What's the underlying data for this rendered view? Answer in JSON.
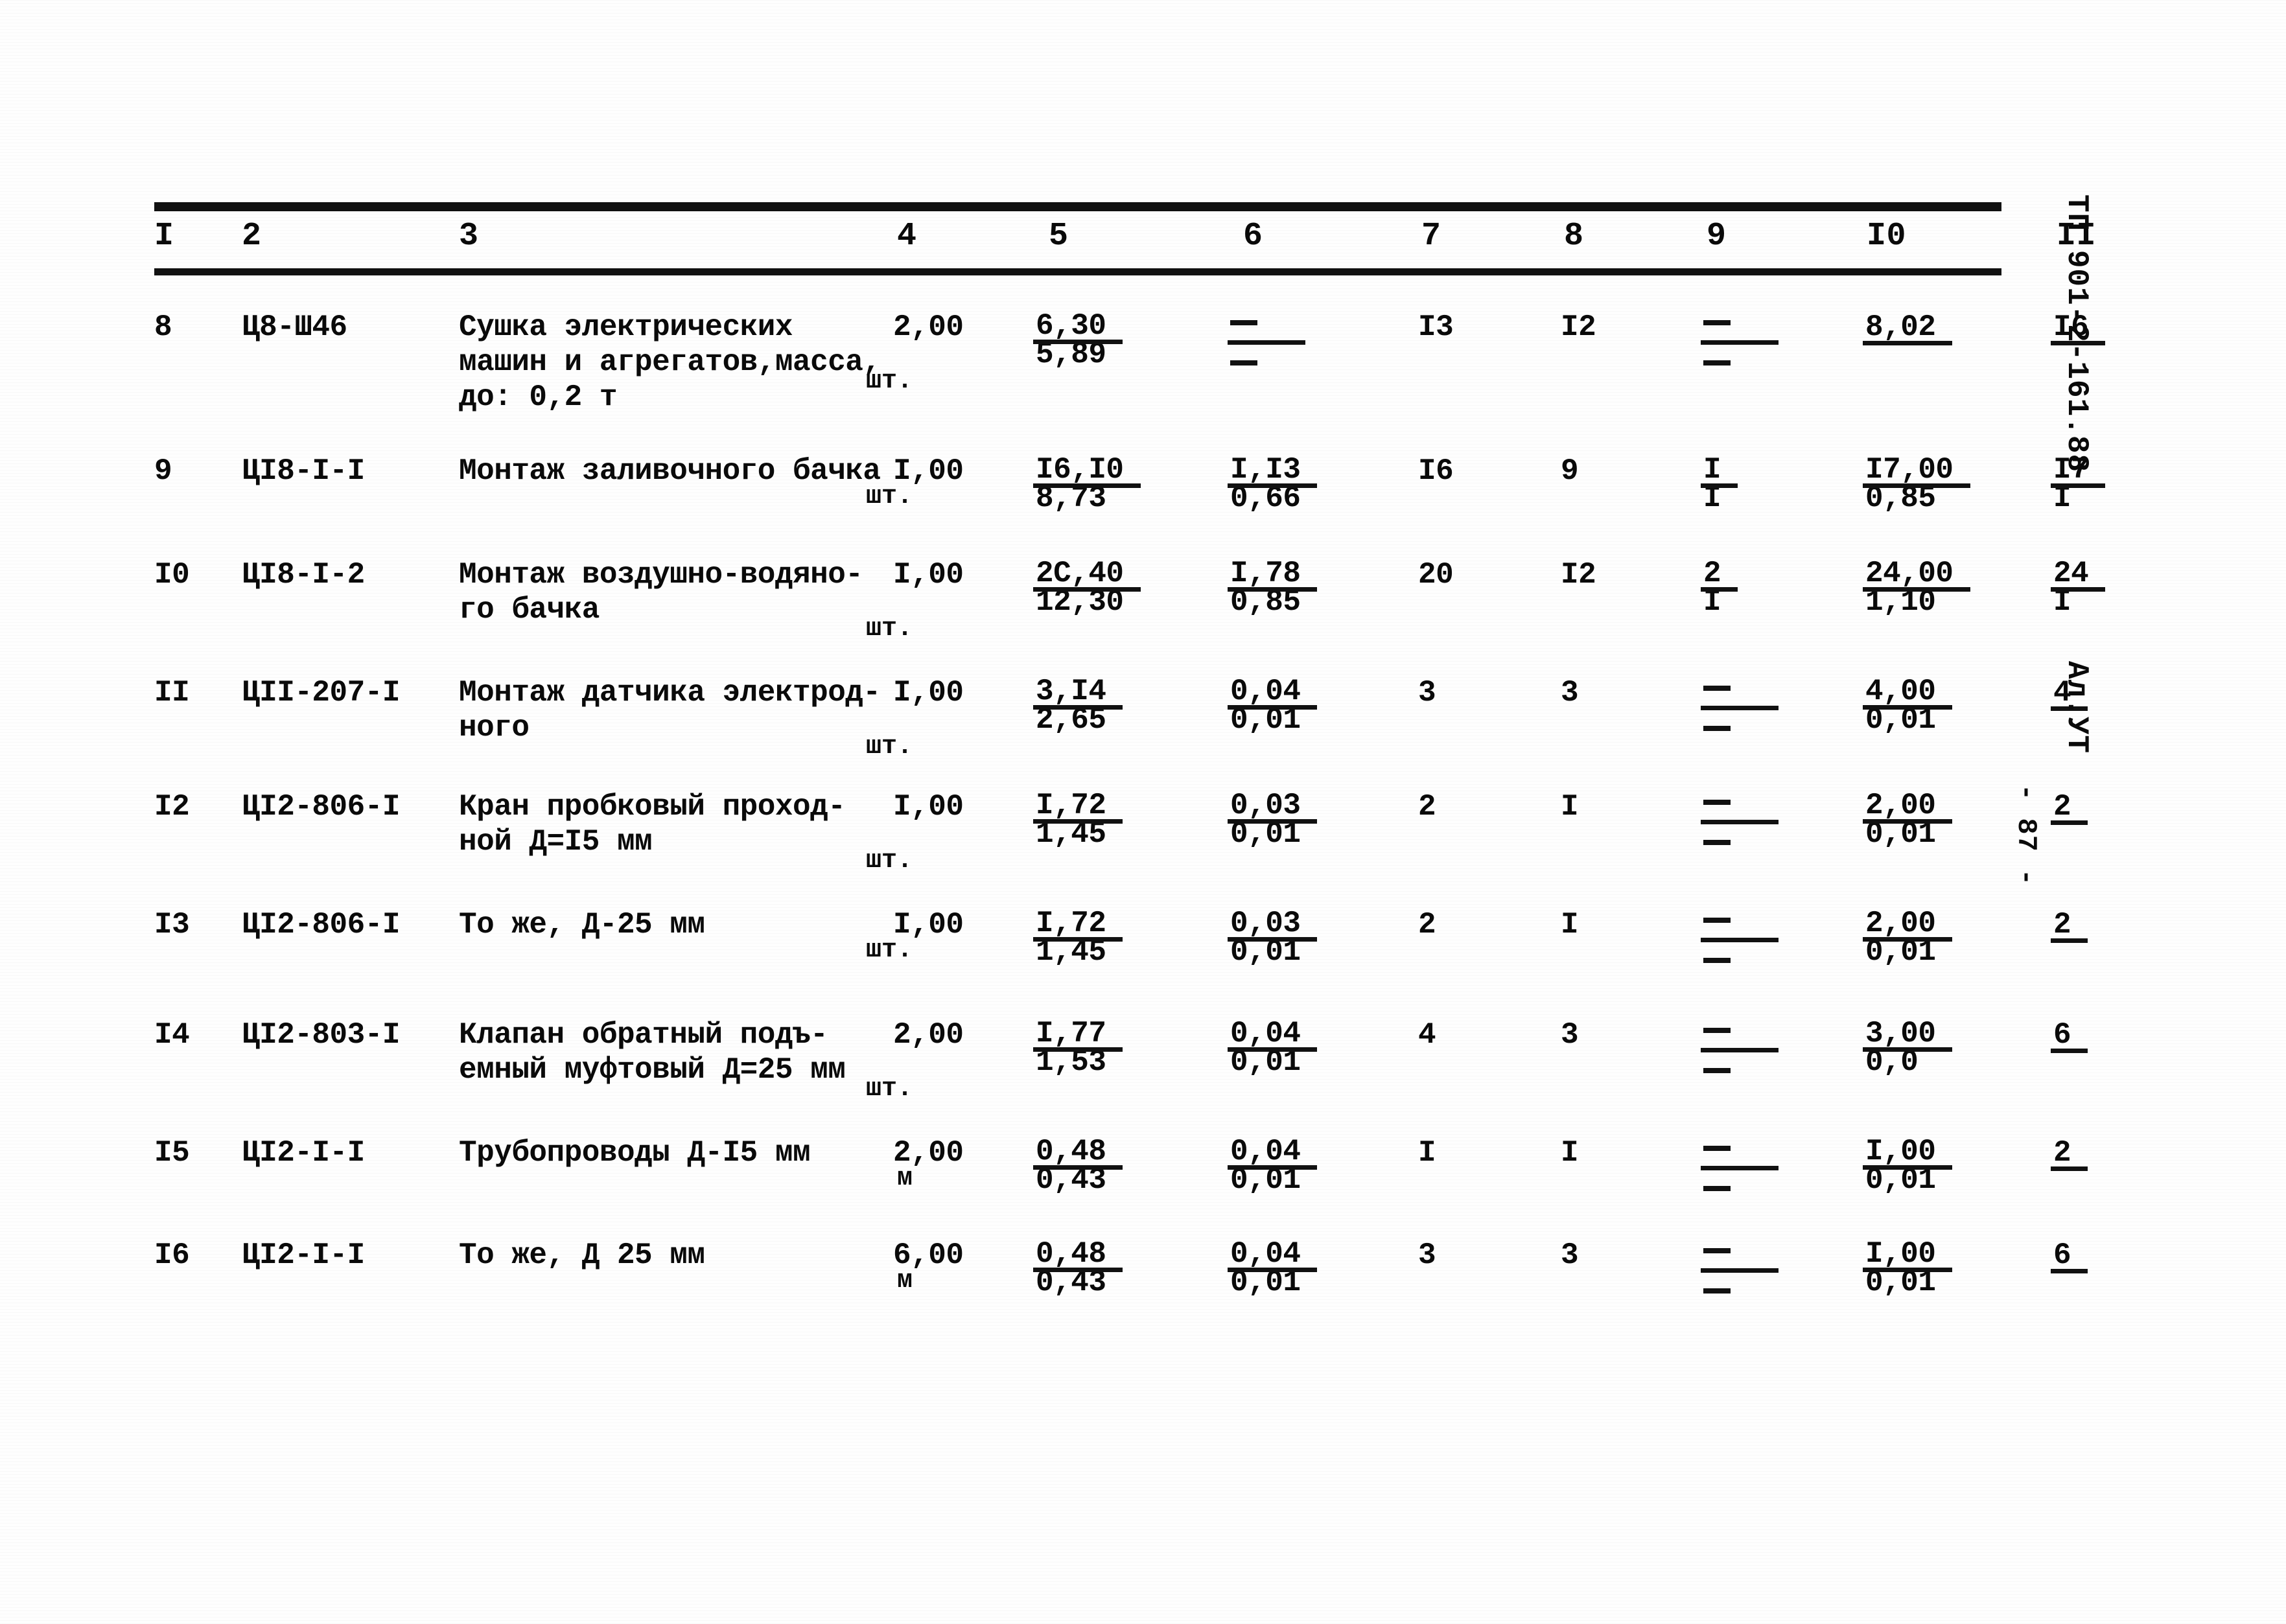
{
  "document": {
    "series_code": "ТП 901-2-161.88",
    "album_code": "Ал.УТ",
    "page_label": "- 87 -"
  },
  "table": {
    "column_headers": [
      "I",
      "2",
      "3",
      "4",
      "5",
      "6",
      "7",
      "8",
      "9",
      "I0",
      "II"
    ],
    "rows": [
      {
        "num": "8",
        "code": "Ц8-Ш46",
        "description": "Сушка электрических\nмашин и агрегатов,масса,\nдо: 0,2 т",
        "unit": "шт.",
        "qty": "2,00",
        "col5_num": "6,30",
        "col5_den": "5,89",
        "col6_num": "",
        "col6_den": "",
        "col7": "I3",
        "col8": "I2",
        "col9_num": "",
        "col9_den": "",
        "col10_num": "8,02",
        "col10_den": "",
        "col11_num": "I6",
        "col11_den": ""
      },
      {
        "num": "9",
        "code": "ЦI8-I-I",
        "description": "Монтаж заливочного бачка",
        "unit": "шт.",
        "qty": "I,00",
        "col5_num": "I6,I0",
        "col5_den": "8,73",
        "col6_num": "I,I3",
        "col6_den": "0,66",
        "col7": "I6",
        "col8": "9",
        "col9_num": "I",
        "col9_den": "I",
        "col10_num": "I7,00",
        "col10_den": "0,85",
        "col11_num": "I7",
        "col11_den": "I"
      },
      {
        "num": "I0",
        "code": "ЦI8-I-2",
        "description": "Монтаж воздушно-водяно-\nго бачка",
        "unit": "шт.",
        "qty": "I,00",
        "col5_num": "2C,40",
        "col5_den": "12,30",
        "col6_num": "I,78",
        "col6_den": "0,85",
        "col7": "20",
        "col8": "I2",
        "col9_num": "2",
        "col9_den": "I",
        "col10_num": "24,00",
        "col10_den": "1,10",
        "col11_num": "24",
        "col11_den": "I"
      },
      {
        "num": "II",
        "code": "ЦII-207-I",
        "description": "Монтаж датчика электрод-\nного",
        "unit": "шт.",
        "qty": "I,00",
        "col5_num": "3,I4",
        "col5_den": "2,65",
        "col6_num": "0,04",
        "col6_den": "0,01",
        "col7": "3",
        "col8": "3",
        "col9_num": "",
        "col9_den": "",
        "col10_num": "4,00",
        "col10_den": "0,01",
        "col11_num": "4",
        "col11_den": ""
      },
      {
        "num": "I2",
        "code": "ЦI2-806-I",
        "description": "Кран пробковый проход-\nной Д=I5 мм",
        "unit": "шт.",
        "qty": "I,00",
        "col5_num": "I,72",
        "col5_den": "1,45",
        "col6_num": "0,03",
        "col6_den": "0,01",
        "col7": "2",
        "col8": "I",
        "col9_num": "",
        "col9_den": "",
        "col10_num": "2,00",
        "col10_den": "0,01",
        "col11_num": "2",
        "col11_den": ""
      },
      {
        "num": "I3",
        "code": "ЦI2-806-I",
        "description": "То же, Д-25 мм",
        "unit": "шт.",
        "qty": "I,00",
        "col5_num": "I,72",
        "col5_den": "1,45",
        "col6_num": "0,03",
        "col6_den": "0,01",
        "col7": "2",
        "col8": "I",
        "col9_num": "",
        "col9_den": "",
        "col10_num": "2,00",
        "col10_den": "0,01",
        "col11_num": "2",
        "col11_den": ""
      },
      {
        "num": "I4",
        "code": "ЦI2-803-I",
        "description": "Клапан обратный подъ-\nемный муфтовый Д=25 мм",
        "unit": "шт.",
        "qty": "2,00",
        "col5_num": "I,77",
        "col5_den": "1,53",
        "col6_num": "0,04",
        "col6_den": "0,01",
        "col7": "4",
        "col8": "3",
        "col9_num": "",
        "col9_den": "",
        "col10_num": "3,00",
        "col10_den": "0,0",
        "col11_num": "6",
        "col11_den": ""
      },
      {
        "num": "I5",
        "code": "ЦI2-I-I",
        "description": "Трубопроводы Д-I5 мм",
        "unit": "м",
        "qty": "2,00",
        "col5_num": "0,48",
        "col5_den": "0,43",
        "col6_num": "0,04",
        "col6_den": "0,01",
        "col7": "I",
        "col8": "I",
        "col9_num": "",
        "col9_den": "",
        "col10_num": "I,00",
        "col10_den": "0,01",
        "col11_num": "2",
        "col11_den": ""
      },
      {
        "num": "I6",
        "code": "ЦI2-I-I",
        "description": "То же, Д 25 мм",
        "unit": "м",
        "qty": "6,00",
        "col5_num": "0,48",
        "col5_den": "0,43",
        "col6_num": "0,04",
        "col6_den": "0,01",
        "col7": "3",
        "col8": "3",
        "col9_num": "",
        "col9_den": "",
        "col10_num": "I,00",
        "col10_den": "0,01",
        "col11_num": "6",
        "col11_den": ""
      }
    ]
  }
}
